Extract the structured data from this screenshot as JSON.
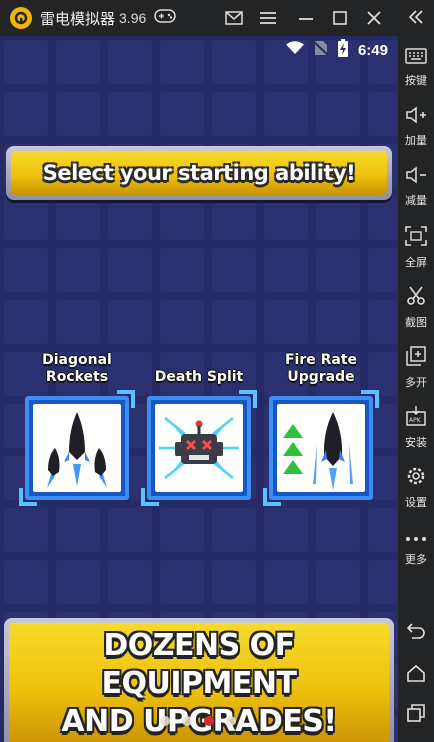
{
  "titlebar": {
    "app_name": "雷电模拟器",
    "version": "3.96"
  },
  "statusbar": {
    "time": "6:49"
  },
  "game": {
    "prompt": "Select your starting ability!",
    "abilities": [
      {
        "label": "Diagonal Rockets",
        "icon": "diagonal-rockets-icon"
      },
      {
        "label": "Death Split",
        "icon": "death-split-icon"
      },
      {
        "label": "Fire Rate Upgrade",
        "icon": "fire-rate-upgrade-icon"
      }
    ],
    "promo_line1": "DOZENS OF EQUIPMENT",
    "promo_line2": "AND UPGRADES!",
    "pager_count": 4,
    "pager_active_index": 2
  },
  "sidebar": {
    "items": [
      {
        "label": "按键",
        "icon": "keyboard-icon"
      },
      {
        "label": "加量",
        "icon": "volume-up-icon"
      },
      {
        "label": "减量",
        "icon": "volume-down-icon"
      },
      {
        "label": "全屏",
        "icon": "fullscreen-icon"
      },
      {
        "label": "截图",
        "icon": "scissors-icon"
      },
      {
        "label": "多开",
        "icon": "multi-instance-icon"
      },
      {
        "label": "安装",
        "icon": "apk-install-icon"
      },
      {
        "label": "设置",
        "icon": "gear-icon"
      },
      {
        "label": "更多",
        "icon": "more-icon"
      }
    ]
  },
  "colors": {
    "game_background": "#262a66",
    "banner_gold": "#eec10f",
    "card_blue": "#1757c4",
    "emulator_chrome": "#232425",
    "pager_active": "#d42b2b"
  }
}
